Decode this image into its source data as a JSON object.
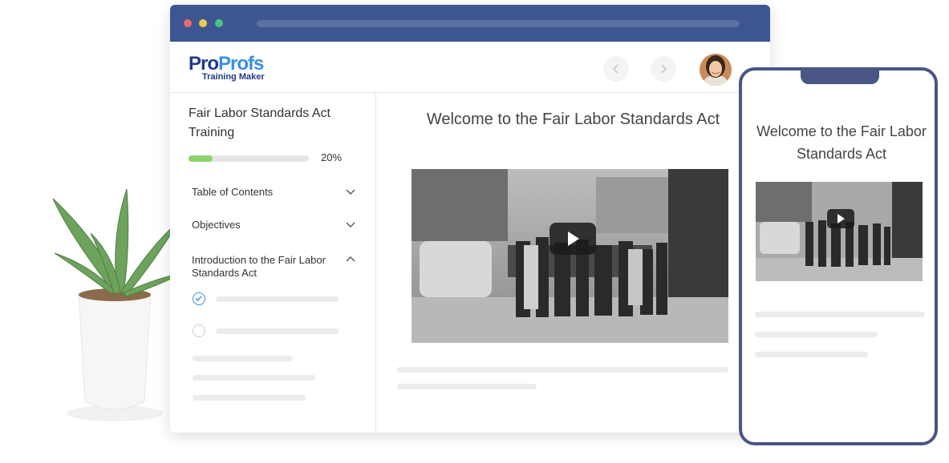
{
  "logo": {
    "brand_part1": "Pro",
    "brand_part2": "Profs",
    "product": "Training Maker"
  },
  "header": {
    "prev_icon": "chevron-left-icon",
    "next_icon": "chevron-right-icon"
  },
  "sidebar": {
    "course_title": "Fair Labor Standards Act Training",
    "progress": {
      "value": 0.2,
      "label": "20%"
    },
    "items": [
      {
        "label": "Table of Contents",
        "expanded": false
      },
      {
        "label": "Objectives",
        "expanded": false
      },
      {
        "label": "Introduction to the Fair Labor Standards Act",
        "expanded": true
      }
    ]
  },
  "main": {
    "title": "Welcome to the Fair Labor Standards Act"
  },
  "phone": {
    "title": "Welcome to the Fair Labor Standards Act"
  },
  "colors": {
    "titlebar": "#3d5691",
    "accent": "#3a8ee6",
    "progress": "#8cd36b",
    "phone_frame": "#4a5684"
  }
}
